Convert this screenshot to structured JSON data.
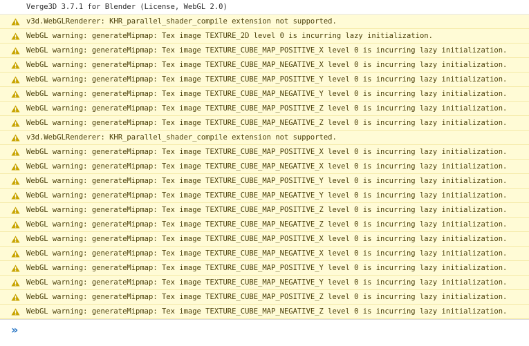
{
  "console": {
    "messages": [
      {
        "level": "info",
        "text": "Verge3D 3.7.1 for Blender (License, WebGL 2.0)"
      },
      {
        "level": "warning",
        "text": "v3d.WebGLRenderer: KHR_parallel_shader_compile extension not supported."
      },
      {
        "level": "warning",
        "text": "WebGL warning: generateMipmap: Tex image TEXTURE_2D level 0 is incurring lazy initialization."
      },
      {
        "level": "warning",
        "text": "WebGL warning: generateMipmap: Tex image TEXTURE_CUBE_MAP_POSITIVE_X level 0 is incurring lazy initialization."
      },
      {
        "level": "warning",
        "text": "WebGL warning: generateMipmap: Tex image TEXTURE_CUBE_MAP_NEGATIVE_X level 0 is incurring lazy initialization."
      },
      {
        "level": "warning",
        "text": "WebGL warning: generateMipmap: Tex image TEXTURE_CUBE_MAP_POSITIVE_Y level 0 is incurring lazy initialization."
      },
      {
        "level": "warning",
        "text": "WebGL warning: generateMipmap: Tex image TEXTURE_CUBE_MAP_NEGATIVE_Y level 0 is incurring lazy initialization."
      },
      {
        "level": "warning",
        "text": "WebGL warning: generateMipmap: Tex image TEXTURE_CUBE_MAP_POSITIVE_Z level 0 is incurring lazy initialization."
      },
      {
        "level": "warning",
        "text": "WebGL warning: generateMipmap: Tex image TEXTURE_CUBE_MAP_NEGATIVE_Z level 0 is incurring lazy initialization."
      },
      {
        "level": "warning",
        "text": "v3d.WebGLRenderer: KHR_parallel_shader_compile extension not supported."
      },
      {
        "level": "warning",
        "text": "WebGL warning: generateMipmap: Tex image TEXTURE_CUBE_MAP_POSITIVE_X level 0 is incurring lazy initialization."
      },
      {
        "level": "warning",
        "text": "WebGL warning: generateMipmap: Tex image TEXTURE_CUBE_MAP_NEGATIVE_X level 0 is incurring lazy initialization."
      },
      {
        "level": "warning",
        "text": "WebGL warning: generateMipmap: Tex image TEXTURE_CUBE_MAP_POSITIVE_Y level 0 is incurring lazy initialization."
      },
      {
        "level": "warning",
        "text": "WebGL warning: generateMipmap: Tex image TEXTURE_CUBE_MAP_NEGATIVE_Y level 0 is incurring lazy initialization."
      },
      {
        "level": "warning",
        "text": "WebGL warning: generateMipmap: Tex image TEXTURE_CUBE_MAP_POSITIVE_Z level 0 is incurring lazy initialization."
      },
      {
        "level": "warning",
        "text": "WebGL warning: generateMipmap: Tex image TEXTURE_CUBE_MAP_NEGATIVE_Z level 0 is incurring lazy initialization."
      },
      {
        "level": "warning",
        "text": "WebGL warning: generateMipmap: Tex image TEXTURE_CUBE_MAP_POSITIVE_X level 0 is incurring lazy initialization."
      },
      {
        "level": "warning",
        "text": "WebGL warning: generateMipmap: Tex image TEXTURE_CUBE_MAP_NEGATIVE_X level 0 is incurring lazy initialization."
      },
      {
        "level": "warning",
        "text": "WebGL warning: generateMipmap: Tex image TEXTURE_CUBE_MAP_POSITIVE_Y level 0 is incurring lazy initialization."
      },
      {
        "level": "warning",
        "text": "WebGL warning: generateMipmap: Tex image TEXTURE_CUBE_MAP_NEGATIVE_Y level 0 is incurring lazy initialization."
      },
      {
        "level": "warning",
        "text": "WebGL warning: generateMipmap: Tex image TEXTURE_CUBE_MAP_POSITIVE_Z level 0 is incurring lazy initialization."
      },
      {
        "level": "warning",
        "text": "WebGL warning: generateMipmap: Tex image TEXTURE_CUBE_MAP_NEGATIVE_Z level 0 is incurring lazy initialization."
      }
    ],
    "icons": {
      "warning": "warning-triangle-icon",
      "prompt": "double-chevron-right-icon"
    },
    "colors": {
      "warning_background": "#fffbd6",
      "warning_icon": "#c8a400",
      "prompt_chevron": "#1e6fc2"
    },
    "prompt": {
      "chevron": "»",
      "input_value": ""
    }
  }
}
